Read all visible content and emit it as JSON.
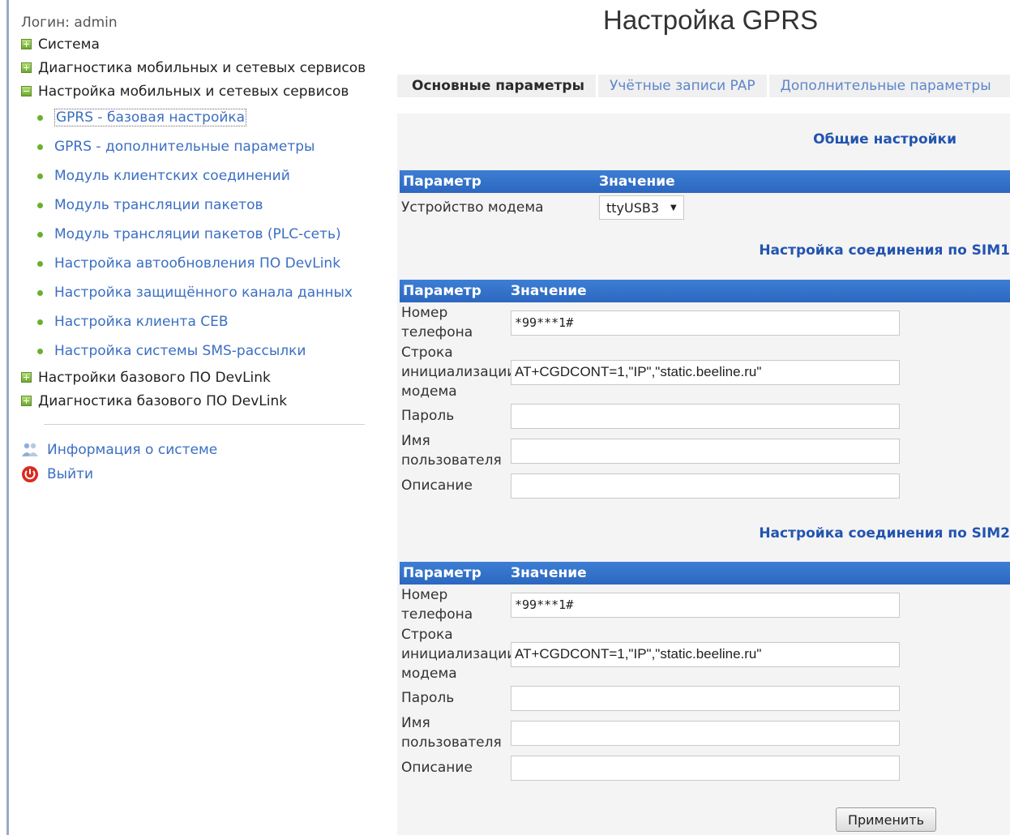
{
  "sidebar": {
    "login": "Логин: admin",
    "top_items": [
      {
        "label": "Система",
        "state": "collapsed"
      },
      {
        "label": "Диагностика мобильных и сетевых сервисов",
        "state": "collapsed"
      },
      {
        "label": "Настройка мобильных и сетевых сервисов",
        "state": "expanded"
      }
    ],
    "sub_items": [
      {
        "label": "GPRS - базовая настройка",
        "active": true
      },
      {
        "label": "GPRS - дополнительные параметры"
      },
      {
        "label": "Модуль клиентских соединений"
      },
      {
        "label": "Модуль трансляции пакетов"
      },
      {
        "label": "Модуль трансляции пакетов (PLC-сеть)"
      },
      {
        "label": "Настройка автообновления ПО DevLink"
      },
      {
        "label": "Настройка защищённого канала данных"
      },
      {
        "label": "Настройка клиента CEB"
      },
      {
        "label": "Настройка системы SMS-рассылки"
      }
    ],
    "bottom_items": [
      {
        "label": "Настройки базового ПО DevLink",
        "state": "collapsed"
      },
      {
        "label": "Диагностика базового ПО DevLink",
        "state": "collapsed"
      }
    ],
    "system_info": {
      "label": "Информация о системе",
      "icon": "info-people-icon"
    },
    "logout": {
      "label": "Выйти",
      "icon": "power-icon"
    }
  },
  "page_title": "Настройка GPRS",
  "tabs": [
    {
      "label": "Основные параметры",
      "active": true
    },
    {
      "label": "Учётные записи PAP"
    },
    {
      "label": "Дополнительные параметры"
    }
  ],
  "general": {
    "title": "Общие настройки",
    "col_param": "Параметр",
    "col_value": "Значение",
    "modem_label": "Устройство модема",
    "modem_value": "ttyUSB3"
  },
  "sim1": {
    "title": "Настройка соединения по SIM1",
    "col_param": "Параметр",
    "col_value": "Значение",
    "phone_label": [
      "Номер",
      "телефона"
    ],
    "phone_value": "*99***1#",
    "init_label": [
      "Строка",
      "инициализации",
      "модема"
    ],
    "init_value": "AT+CGDCONT=1,\"IP\",\"static.beeline.ru\"",
    "password_label": "Пароль",
    "password_value": "",
    "user_label": [
      "Имя",
      "пользователя"
    ],
    "user_value": "",
    "desc_label": "Описание",
    "desc_value": ""
  },
  "sim2": {
    "title": "Настройка соединения по SIM2",
    "col_param": "Параметр",
    "col_value": "Значение",
    "phone_label": [
      "Номер",
      "телефона"
    ],
    "phone_value": "*99***1#",
    "init_label": [
      "Строка",
      "инициализации",
      "модема"
    ],
    "init_value": "AT+CGDCONT=1,\"IP\",\"static.beeline.ru\"",
    "password_label": "Пароль",
    "password_value": "",
    "user_label": [
      "Имя",
      "пользователя"
    ],
    "user_value": "",
    "desc_label": "Описание",
    "desc_value": ""
  },
  "apply_label": "Применить",
  "colors": {
    "header_blue": "#2c67c0",
    "link_blue": "#3b6fc2",
    "section_title_blue": "#2254b0",
    "tree_green": "#6ea82f"
  }
}
